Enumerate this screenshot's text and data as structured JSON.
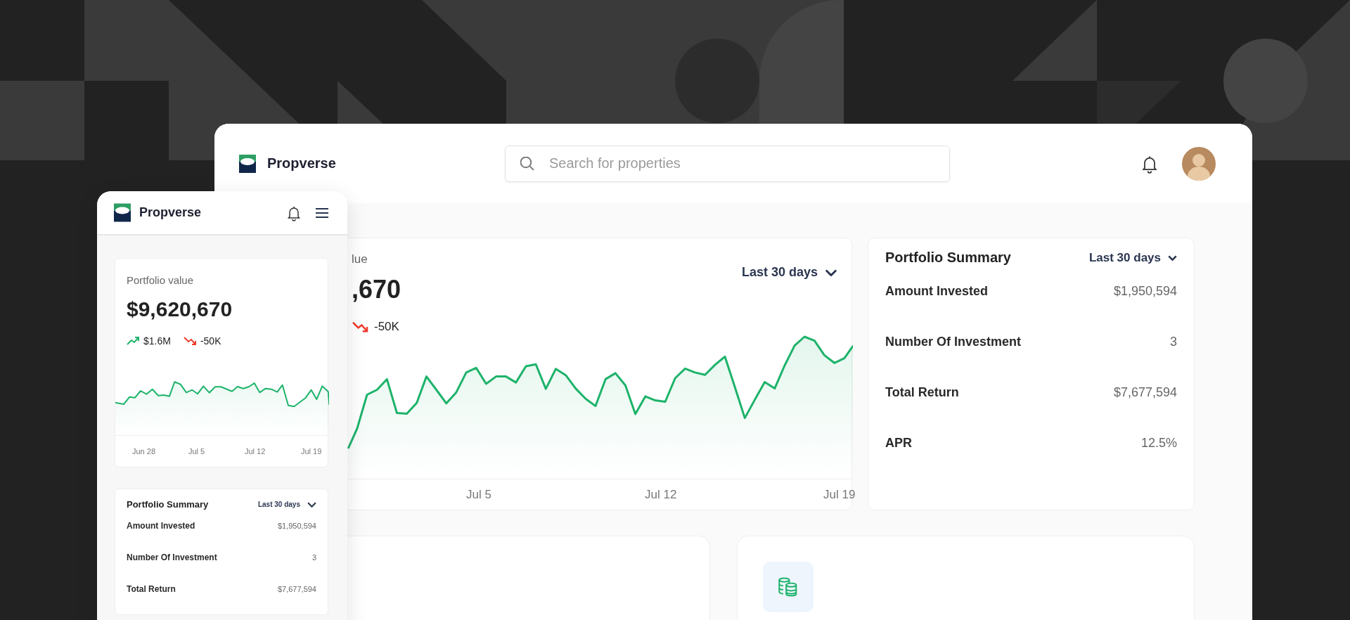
{
  "desktop": {
    "brand": "Propverse",
    "search": {
      "placeholder": "Search for properties"
    },
    "value_card": {
      "label": "lue",
      "value": ",670",
      "period": "Last 30 days",
      "trends": [
        {
          "kind": "down",
          "text": "-50K"
        }
      ],
      "x_labels": [
        "Jul 5",
        "Jul 12",
        "Jul 19"
      ]
    },
    "summary": {
      "title": "Portfolio Summary",
      "period": "Last 30 days",
      "rows": [
        {
          "label": "Amount Invested",
          "value": "$1,950,594"
        },
        {
          "label": "Number Of Investment",
          "value": "3"
        },
        {
          "label": "Total Return",
          "value": "$7,677,594"
        },
        {
          "label": "APR",
          "value": "12.5%"
        }
      ]
    }
  },
  "mobile": {
    "brand": "Propverse",
    "value_card": {
      "label": "Portfolio value",
      "value": "$9,620,670",
      "trends": [
        {
          "kind": "up",
          "text": "$1.6M"
        },
        {
          "kind": "down",
          "text": "-50K"
        }
      ],
      "x_labels": [
        "Jun 28",
        "Jul 5",
        "Jul 12",
        "Jul 19"
      ]
    },
    "summary": {
      "title": "Portfolio Summary",
      "period": "Last 30 days",
      "rows": [
        {
          "label": "Amount Invested",
          "value": "$1,950,594"
        },
        {
          "label": "Number Of Investment",
          "value": "3"
        },
        {
          "label": "Total Return",
          "value": "$7,677,594"
        }
      ]
    }
  }
}
